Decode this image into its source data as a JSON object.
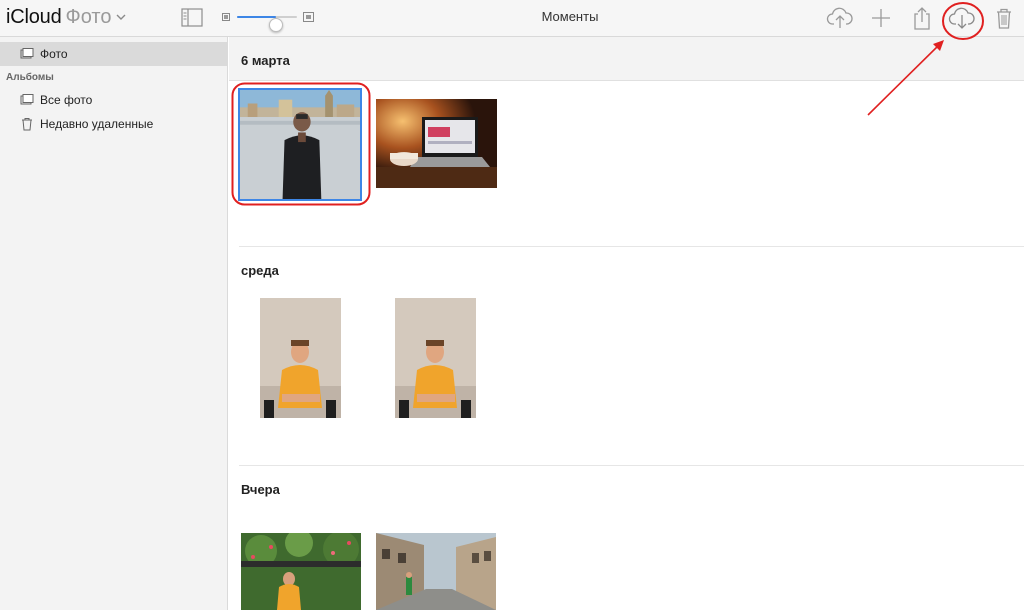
{
  "header": {
    "brand": "iCloud",
    "app_name": "Фото",
    "page_title": "Моменты",
    "zoom_level": 0.65,
    "toolbar_icons": [
      "sidebar-toggle-icon",
      "zoom-small-icon",
      "zoom-large-icon",
      "upload-cloud-icon",
      "add-icon",
      "share-icon",
      "download-cloud-icon",
      "trash-icon"
    ]
  },
  "sidebar": {
    "top_item": {
      "label": "Фото",
      "icon": "photos-icon",
      "selected": true
    },
    "section_label": "Альбомы",
    "albums": [
      {
        "label": "Все фото",
        "icon": "album-icon"
      },
      {
        "label": "Недавно удаленные",
        "icon": "trash-icon"
      }
    ]
  },
  "moments": [
    {
      "title": "6 марта",
      "photos": [
        "man-by-river-photo",
        "laptop-night-photo"
      ]
    },
    {
      "title": "среда",
      "photos": [
        "man-yellow-shirt-photo-1",
        "man-yellow-shirt-photo-2"
      ]
    },
    {
      "title": "Вчера",
      "photos": [
        "man-in-garden-photo",
        "street-photo"
      ]
    }
  ],
  "annotations": {
    "highlight_color": "#e02020"
  },
  "colors": {
    "accent": "#3d86e6",
    "selection": "#3d86e6"
  }
}
